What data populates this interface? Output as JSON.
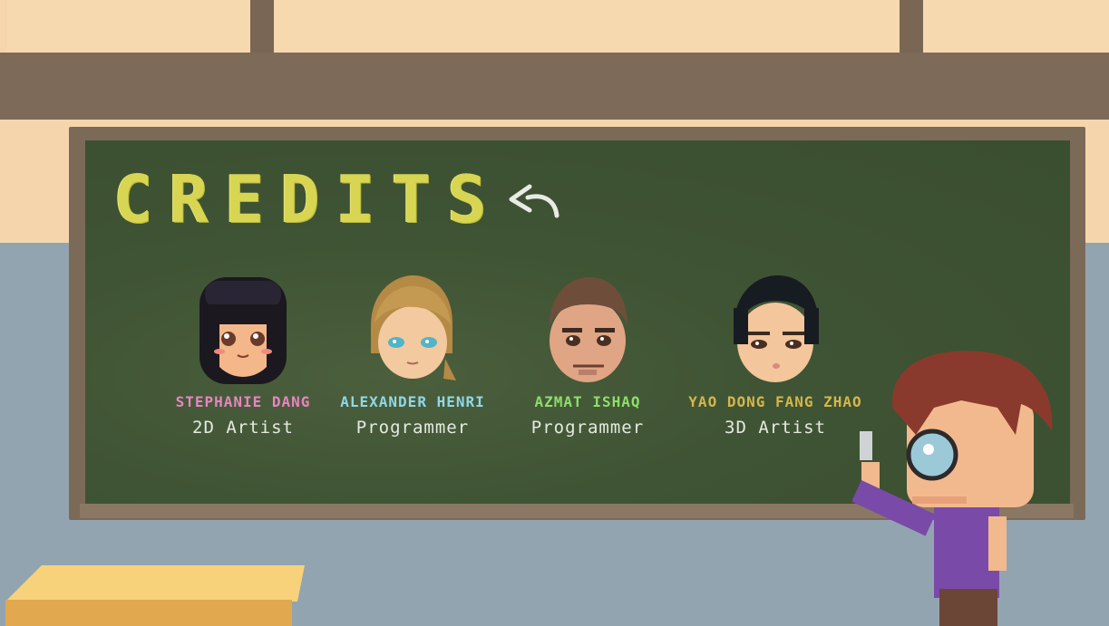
{
  "screen": {
    "title": "CREDITS",
    "back_icon": "curved-back-arrow-icon"
  },
  "team": [
    {
      "name": "STEPHANIE DANG",
      "role": "2D Artist",
      "color": "#e884c2"
    },
    {
      "name": "ALEXANDER HENRI",
      "role": "Programmer",
      "color": "#8fd8e6"
    },
    {
      "name": "AZMAT ISHAQ",
      "role": "Programmer",
      "color": "#8ede6a"
    },
    {
      "name": "YAO DONG FANG ZHAO",
      "role": "3D Artist",
      "color": "#d4b74a"
    }
  ],
  "colors": {
    "chalkboard": "#3f5434",
    "title_chalk": "#d7d552",
    "frame": "#7c6a58"
  }
}
